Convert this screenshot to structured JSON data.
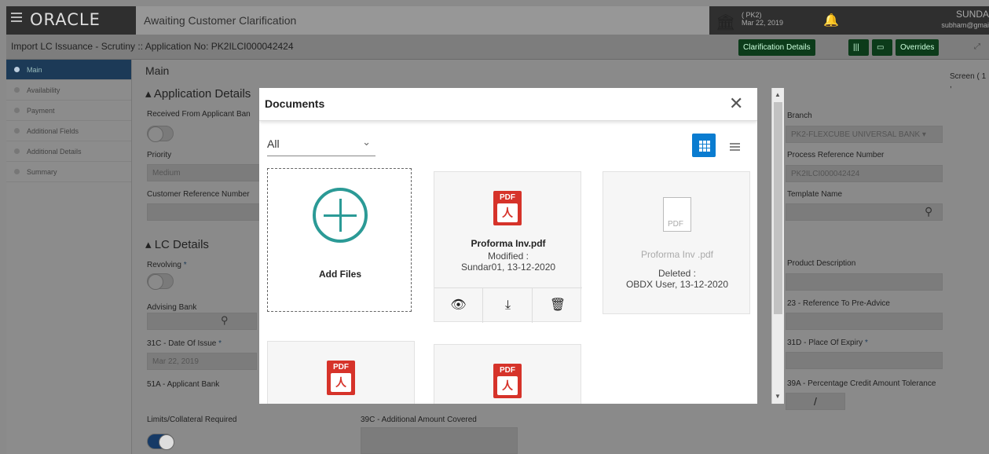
{
  "header": {
    "logo": "ORACLE",
    "workflow_title": "Awaiting Customer Clarification",
    "branch_code": "( PK2)",
    "branch_date": "Mar 22, 2019",
    "user_name": "SUNDA",
    "user_email": "subham@gmai"
  },
  "subheader": {
    "application": "Import LC Issuance - Scrutiny :: Application No: PK2ILCI000042424",
    "buttons": [
      "Clarification Details",
      "Overrides"
    ]
  },
  "sidebar": {
    "items": [
      {
        "label": "Main"
      },
      {
        "label": "Availability"
      },
      {
        "label": "Payment"
      },
      {
        "label": "Additional Fields"
      },
      {
        "label": "Additional Details"
      },
      {
        "label": "Summary"
      }
    ]
  },
  "main": {
    "title": "Main",
    "screen": "Screen ( 1 ,",
    "application_details": "Application Details",
    "received_label": "Received From Applicant Ban",
    "priority_label": "Priority",
    "priority_value": "Medium",
    "customer_ref_label": "Customer Reference Number",
    "lc_details": "LC Details",
    "revolving_label": "Revolving",
    "advising_bank_label": "Advising Bank",
    "date_issue_label": "31C - Date Of Issue",
    "date_issue_value": "Mar 22, 2019",
    "applicant_bank_label": "51A - Applicant Bank",
    "limits_label": "Limits/Collateral Required",
    "additional_amount_label": "39C - Additional Amount Covered",
    "branch_label": "Branch",
    "branch_value": "PK2-FLEXCUBE UNIVERSAL BANK",
    "process_ref_label": "Process Reference Number",
    "process_ref_value": "PK2ILCI000042424",
    "template_label": "Template Name",
    "product_desc_label": "Product Description",
    "ref_pre_advice_label": "23 - Reference To Pre-Advice",
    "place_expiry_label": "31D - Place Of Expiry",
    "tolerance_label": "39A - Percentage Credit Amount Tolerance",
    "tolerance_sep": "/",
    "required_mark": "*"
  },
  "modal": {
    "title": "Documents",
    "filter": "All",
    "add_files": "Add Files",
    "docs": [
      {
        "name": "Proforma Inv.pdf",
        "status": "Modified :",
        "by": "Sundar01, 13-12-2020"
      },
      {
        "name": "Proforma Inv .pdf",
        "status": "Deleted :",
        "by": "OBDX User, 13-12-2020"
      }
    ]
  },
  "icons": {
    "pdf_label": "PDF"
  }
}
